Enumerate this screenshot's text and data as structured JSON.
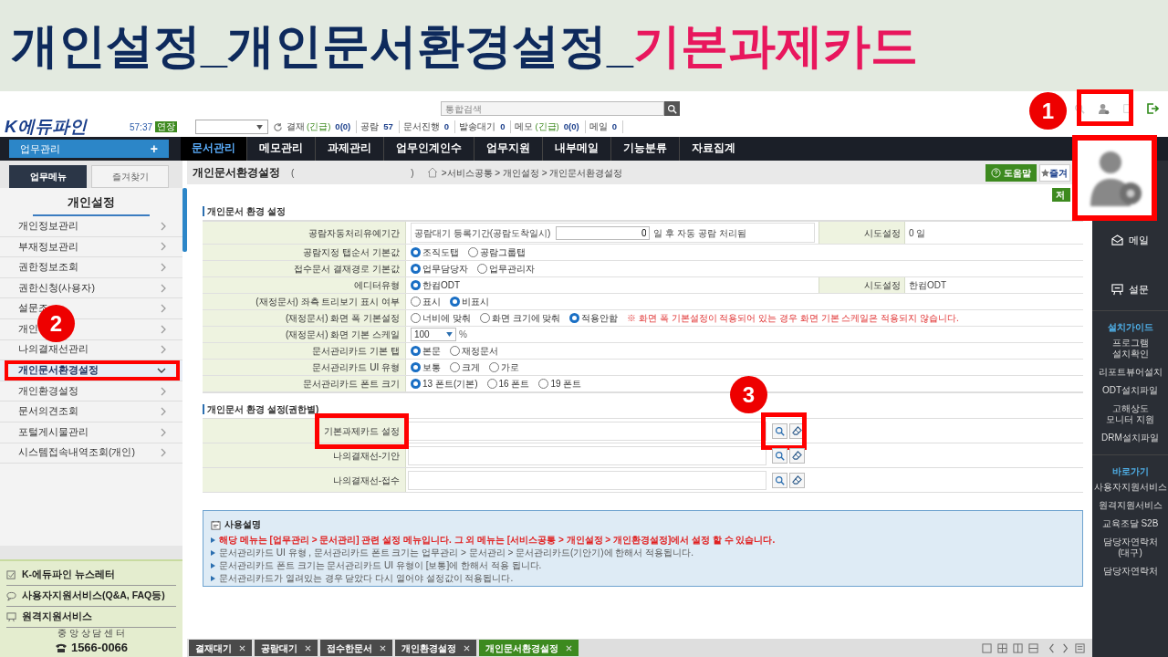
{
  "title": [
    {
      "text": "개인설정_개인문서환경설정_",
      "highlight": false
    },
    {
      "text": "기본과제카드",
      "highlight": true
    }
  ],
  "header": {
    "logo": "K에듀파인",
    "session_time": "57:37",
    "extend_badge": "연장",
    "search": {
      "placeholder": "통합검색"
    },
    "status": [
      {
        "label": "결재",
        "urgent": "(긴급)",
        "count": "0(0)"
      },
      {
        "label": "공람",
        "count": "57"
      },
      {
        "label": "문서진행",
        "count": "0"
      },
      {
        "label": "발송대기",
        "count": "0"
      },
      {
        "label": "메모",
        "urgent": "(긴급)",
        "count": "0(0)"
      },
      {
        "label": "메일",
        "count": "0"
      }
    ]
  },
  "nav": {
    "menu_button": "업무관리",
    "menu_symbol": "+",
    "items": [
      {
        "label": "문서관리",
        "selected": true
      },
      {
        "label": "메모관리",
        "selected": false
      },
      {
        "label": "과제관리",
        "selected": false
      },
      {
        "label": "업무인계인수",
        "selected": false
      },
      {
        "label": "업무지원",
        "selected": false
      },
      {
        "label": "내부메일",
        "selected": false
      },
      {
        "label": "기능분류",
        "selected": false
      },
      {
        "label": "자료집계",
        "selected": false
      }
    ]
  },
  "sidebar": {
    "tabs": [
      {
        "label": "업무메뉴",
        "selected": true
      },
      {
        "label": "즐겨찾기",
        "selected": false
      }
    ],
    "title": "개인설정",
    "items": [
      {
        "label": "개인정보관리",
        "selected": false,
        "highlighted": false
      },
      {
        "label": "부재정보관리",
        "selected": false,
        "highlighted": false
      },
      {
        "label": "권한정보조회",
        "selected": false,
        "highlighted": false
      },
      {
        "label": "권한신청(사용자)",
        "selected": false,
        "highlighted": false
      },
      {
        "label": "설문조",
        "selected": false,
        "highlighted": false
      },
      {
        "label": "개인",
        "selected": false,
        "highlighted": false
      },
      {
        "label": "나의결재선관리",
        "selected": false,
        "highlighted": false
      },
      {
        "label": "개인문서환경설정",
        "selected": true,
        "highlighted": true
      },
      {
        "label": "개인환경설정",
        "selected": false,
        "highlighted": false
      },
      {
        "label": "문서의견조회",
        "selected": false,
        "highlighted": false
      },
      {
        "label": "포털게시물관리",
        "selected": false,
        "highlighted": false
      },
      {
        "label": "시스템접속내역조회(개인)",
        "selected": false,
        "highlighted": false
      }
    ],
    "footer_links": [
      "K-에듀파인 뉴스레터",
      "사용자지원서비스(Q&A, FAQ등)",
      "원격지원서비스"
    ],
    "center_label": "중 앙 상 담 센 터",
    "phone": "1566-0066"
  },
  "page": {
    "title": "개인문서환경설정",
    "title_brackets": [
      "(",
      ")"
    ],
    "breadcrumb": ">서비스공통 > 개인설정 > 개인문서환경설정",
    "help_button": "도움말",
    "bookmark_button": "즐겨",
    "save_button": "저",
    "section1": {
      "heading": "개인문서 환경 설정",
      "rows": [
        {
          "kind": "period",
          "label": "공람자동처리유예기간",
          "prefix": "공람대기 등록기간(공람도착일시)",
          "value": "0",
          "suffix": "일 후 자동 공람 처리됨",
          "side_label": "시도설정",
          "side_value": "0 일"
        },
        {
          "kind": "radio",
          "label": "공람지정 탭순서 기본값",
          "options": [
            {
              "label": "조직도탭",
              "selected": true
            },
            {
              "label": "공람그룹탭",
              "selected": false
            }
          ]
        },
        {
          "kind": "radio",
          "label": "접수문서 결재경로 기본값",
          "options": [
            {
              "label": "업무담당자",
              "selected": true
            },
            {
              "label": "업무관리자",
              "selected": false
            }
          ]
        },
        {
          "kind": "radio",
          "label": "에디터유형",
          "options": [
            {
              "label": "한컴ODT",
              "selected": true
            }
          ],
          "side_label": "시도설정",
          "side_value": "한컴ODT"
        },
        {
          "kind": "radio",
          "label": "(재정문서) 좌측 트리보기 표시 여부",
          "options": [
            {
              "label": "표시",
              "selected": false
            },
            {
              "label": "비표시",
              "selected": true
            }
          ]
        },
        {
          "kind": "radio",
          "label": "(재정문서) 화면 폭 기본설정",
          "options": [
            {
              "label": "너비에 맞춰",
              "selected": false
            },
            {
              "label": "화면 크기에 맞춰",
              "selected": false
            },
            {
              "label": "적용안함",
              "selected": true
            }
          ],
          "note": "※ 화면 폭 기본설정이 적용되어 있는 경우 화면 기본 스케일은 적용되지 않습니다."
        },
        {
          "kind": "select",
          "label": "(재정문서) 화면 기본 스케일",
          "value": "100",
          "unit": "%"
        },
        {
          "kind": "radio",
          "label": "문서관리카드 기본 탭",
          "options": [
            {
              "label": "본문",
              "selected": true
            },
            {
              "label": "재정문서",
              "selected": false
            }
          ]
        },
        {
          "kind": "radio",
          "label": "문서관리카드 UI 유형",
          "options": [
            {
              "label": "보통",
              "selected": true
            },
            {
              "label": "크게",
              "selected": false
            },
            {
              "label": "가로",
              "selected": false
            }
          ]
        },
        {
          "kind": "radio",
          "label": "문서관리카드 폰트 크기",
          "options": [
            {
              "label": "13 폰트(기본)",
              "selected": true
            },
            {
              "label": "16 폰트",
              "selected": false
            },
            {
              "label": "19 폰트",
              "selected": false
            }
          ]
        }
      ]
    },
    "section2": {
      "heading": "개인문서 환경 설정(권한별)",
      "rows": [
        {
          "label": "기본과제카드 설정",
          "highlighted": true
        },
        {
          "label": "나의결재선-기안",
          "highlighted": false
        },
        {
          "label": "나의결재선-접수",
          "highlighted": false
        }
      ]
    },
    "help": {
      "title": "사용설명",
      "lines": [
        {
          "text": "해당 메뉴는 [업무관리 > 문서관리] 관련 설정 메뉴입니다. 그 외 메뉴는 [서비스공통 > 개인설정 > 개인환경설정]에서 설정 할 수 있습니다.",
          "emphasis": true
        },
        {
          "text": "문서관리카드 UI 유형 , 문서관리카드 폰트 크기는 업무관리 > 문서관리 > 문서관리카드(기안기)에 한해서 적용됩니다.",
          "emphasis": false
        },
        {
          "text": "문서관리카드 폰트 크기는 문서관리카드 UI 유형이 [보통]에 한해서 적용 됩니다.",
          "emphasis": false
        },
        {
          "text": "문서관리카드가 열려있는 경우 닫았다 다시 열어야 설정값이 적용됩니다.",
          "emphasis": false
        }
      ]
    },
    "open_tabs": [
      {
        "label": "결재대기",
        "selected": false
      },
      {
        "label": "공람대기",
        "selected": false
      },
      {
        "label": "접수한문서",
        "selected": false
      },
      {
        "label": "개인환경설정",
        "selected": false
      },
      {
        "label": "개인문서환경설정",
        "selected": true
      }
    ]
  },
  "right_panel": [
    {
      "kind": "icon_link",
      "label": "메일"
    },
    {
      "kind": "icon_link",
      "label": "설문"
    },
    {
      "kind": "heading",
      "label": "설치가이드"
    },
    {
      "kind": "link",
      "label": "프로그램\n설치확인"
    },
    {
      "kind": "link",
      "label": "리포트뷰어설치"
    },
    {
      "kind": "link",
      "label": "ODT설치파일"
    },
    {
      "kind": "link",
      "label": "고해상도\n모니터 지원"
    },
    {
      "kind": "link",
      "label": "DRM설치파일"
    },
    {
      "kind": "heading",
      "label": "바로가기"
    },
    {
      "kind": "link",
      "label": "사용자지원서비스"
    },
    {
      "kind": "link",
      "label": "원격지원서비스"
    },
    {
      "kind": "link",
      "label": "교육조달 S2B"
    },
    {
      "kind": "link",
      "label": "담당자연락처\n(대구)"
    },
    {
      "kind": "link",
      "label": "담당자연락처"
    }
  ],
  "callouts": [
    "1",
    "2",
    "3"
  ]
}
